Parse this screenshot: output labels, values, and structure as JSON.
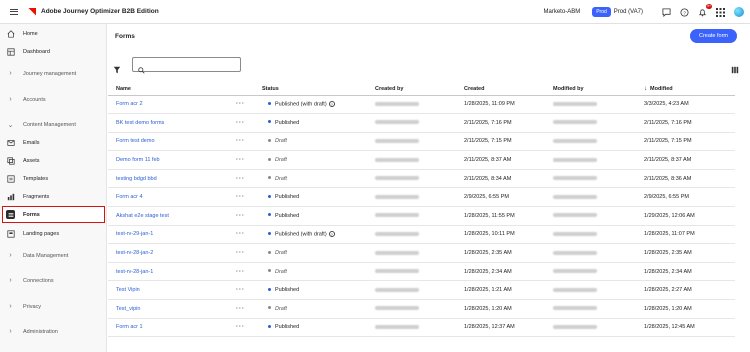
{
  "topbar": {
    "app_title": "Adobe Journey Optimizer B2B Edition",
    "org": "Marketo-ABM",
    "env_badge": "Prod",
    "sandbox": "Prod (VA7)",
    "notification_count": "9+",
    "icons": [
      "menu-icon",
      "adobe-logo",
      "chat-icon",
      "help-icon",
      "bell-icon",
      "apps-grid-icon",
      "user-avatar"
    ]
  },
  "sidebar": {
    "items": [
      {
        "label": "Home",
        "icon": "home-icon",
        "type": "link"
      },
      {
        "label": "Dashboard",
        "icon": "dashboard-icon",
        "type": "link"
      },
      {
        "label": "Journey management",
        "icon": "chevron-right-icon",
        "type": "group"
      },
      {
        "label": "Accounts",
        "icon": "chevron-right-icon",
        "type": "group"
      },
      {
        "label": "Content Management",
        "icon": "chevron-down-icon",
        "type": "group"
      },
      {
        "label": "Emails",
        "icon": "email-icon",
        "type": "link"
      },
      {
        "label": "Assets",
        "icon": "assets-icon",
        "type": "link"
      },
      {
        "label": "Templates",
        "icon": "templates-icon",
        "type": "link"
      },
      {
        "label": "Fragments",
        "icon": "fragments-icon",
        "type": "link"
      },
      {
        "label": "Forms",
        "icon": "forms-icon",
        "type": "link",
        "active": true
      },
      {
        "label": "Landing pages",
        "icon": "landing-pages-icon",
        "type": "link"
      },
      {
        "label": "Data Management",
        "icon": "chevron-right-icon",
        "type": "group"
      },
      {
        "label": "Connections",
        "icon": "chevron-right-icon",
        "type": "group"
      },
      {
        "label": "Privacy",
        "icon": "chevron-right-icon",
        "type": "group"
      },
      {
        "label": "Administration",
        "icon": "chevron-right-icon",
        "type": "group"
      }
    ]
  },
  "main": {
    "title": "Forms",
    "create_button": "Create form",
    "search_placeholder": "",
    "columns": {
      "name": "Name",
      "status": "Status",
      "created_by": "Created by",
      "created": "Created",
      "modified_by": "Modified by",
      "modified": "Modified"
    },
    "rows": [
      {
        "name": "Form acr 2",
        "status": "Published (with draft)",
        "kind": "published",
        "help": true,
        "created": "1/28/2025, 11:09 PM",
        "modified": "3/3/2025, 4:23 AM"
      },
      {
        "name": "BK test demo forms",
        "status": "Published",
        "kind": "published",
        "created": "2/11/2025, 7:16 PM",
        "modified": "2/11/2025, 7:16 PM"
      },
      {
        "name": "Form test demo",
        "status": "Draft",
        "kind": "draft",
        "created": "2/11/2025, 7:15 PM",
        "modified": "2/11/2025, 7:15 PM"
      },
      {
        "name": "Demo form 11 feb",
        "status": "Draft",
        "kind": "draft",
        "created": "2/11/2025, 8:37 AM",
        "modified": "2/11/2025, 8:37 AM"
      },
      {
        "name": "testing bdgd bbd",
        "status": "Draft",
        "kind": "draft",
        "created": "2/11/2025, 8:34 AM",
        "modified": "2/11/2025, 8:36 AM"
      },
      {
        "name": "Form acr 4",
        "status": "Published",
        "kind": "published",
        "created": "2/9/2025, 6:55 PM",
        "modified": "2/9/2025, 6:55 PM"
      },
      {
        "name": "Akshat e2e stage test",
        "status": "Published",
        "kind": "published",
        "created": "1/28/2025, 11:55 PM",
        "modified": "1/29/2025, 12:06 AM"
      },
      {
        "name": "test-rv-29-jan-1",
        "status": "Published (with draft)",
        "kind": "published",
        "help": true,
        "created": "1/28/2025, 10:11 PM",
        "modified": "1/28/2025, 11:07 PM"
      },
      {
        "name": "test-rv-28-jan-2",
        "status": "Draft",
        "kind": "draft",
        "created": "1/28/2025, 2:35 AM",
        "modified": "1/28/2025, 2:35 AM"
      },
      {
        "name": "test-rv-28-jan-1",
        "status": "Draft",
        "kind": "draft",
        "created": "1/28/2025, 2:34 AM",
        "modified": "1/28/2025, 2:34 AM"
      },
      {
        "name": "Test Vipin",
        "status": "Published",
        "kind": "published",
        "created": "1/28/2025, 1:21 AM",
        "modified": "1/28/2025, 2:27 AM"
      },
      {
        "name": "Test_vipin",
        "status": "Draft",
        "kind": "draft",
        "created": "1/28/2025, 1:20 AM",
        "modified": "1/28/2025, 1:20 AM"
      },
      {
        "name": "Form acr 1",
        "status": "Published",
        "kind": "published",
        "created": "1/28/2025, 12:37 AM",
        "modified": "1/28/2025, 12:45 AM"
      }
    ]
  },
  "colors": {
    "accent": "#3b63fb",
    "published_dot": "#2c5fd4",
    "draft_dot": "#8a8a8a",
    "active_outline": "#d31510"
  }
}
